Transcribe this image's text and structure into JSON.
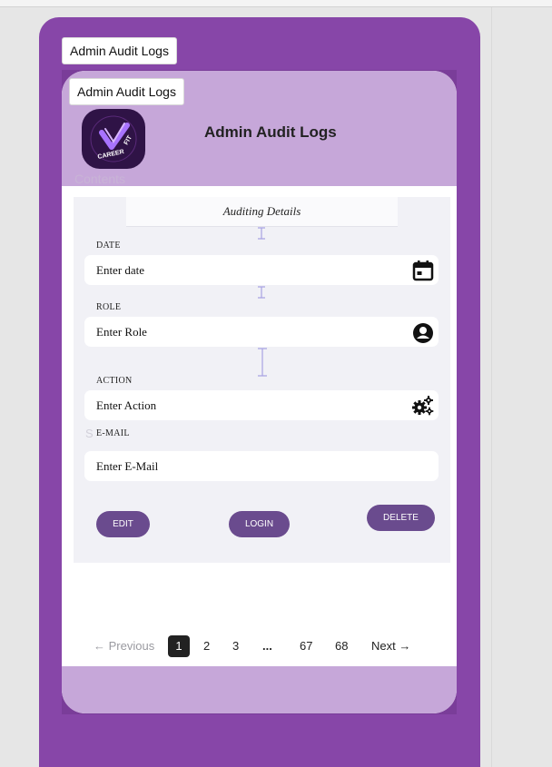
{
  "frame": {
    "tag": "Admin Audit Logs"
  },
  "card": {
    "tag": "Admin Audit Logs",
    "title": "Admin Audit Logs",
    "logo": {
      "text_top": "CAREER",
      "text_bottom": "FIT"
    },
    "contents_label": "Contents"
  },
  "form": {
    "section_title": "Auditing Details",
    "fields": [
      {
        "label": "DATE",
        "value": "Enter date",
        "icon": "calendar-icon"
      },
      {
        "label": "ROLE",
        "value": "Enter Role",
        "icon": "user-circle-icon"
      },
      {
        "label": "ACTION",
        "value": "Enter Action",
        "icon": "gears-icon"
      },
      {
        "label": "E-MAIL",
        "value": "Enter E-Mail",
        "icon": ""
      }
    ],
    "stray_char": "S",
    "buttons": {
      "edit": "EDIT",
      "login": "LOGIN",
      "delete": "DELETE"
    }
  },
  "pagination": {
    "previous": "← Previous",
    "pages": [
      "1",
      "2",
      "3",
      "...",
      "67",
      "68"
    ],
    "current": "1",
    "next": "Next →"
  },
  "colors": {
    "frame": "#8746a8",
    "header": "#c6a7d9",
    "button": "#6a4b8e",
    "panel": "#f1f1f6"
  }
}
